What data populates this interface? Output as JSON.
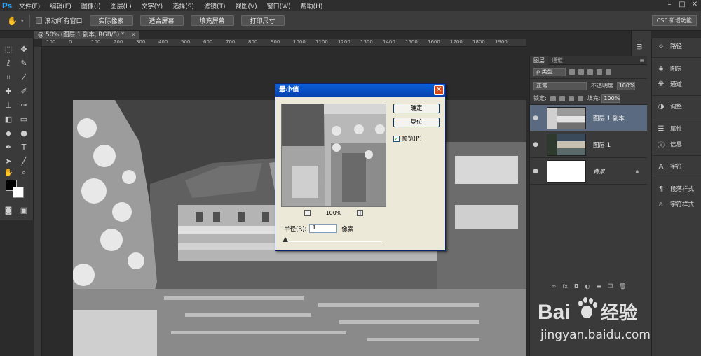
{
  "menubar": {
    "logo": "Ps",
    "items": [
      "文件(F)",
      "编辑(E)",
      "图像(I)",
      "图层(L)",
      "文字(Y)",
      "选择(S)",
      "滤镜(T)",
      "视图(V)",
      "窗口(W)",
      "帮助(H)"
    ]
  },
  "options": {
    "scroll_all_label": "滚动所有窗口",
    "buttons": [
      "实际像素",
      "适合屏幕",
      "填充屏幕",
      "打印尺寸"
    ],
    "workspace": "CS6 新增功能"
  },
  "document": {
    "tab_title": "@ 50% (图层 1 副本, RGB/8) *",
    "ruler_ticks": [
      "100",
      "0",
      "100",
      "200",
      "300",
      "400",
      "500",
      "600",
      "700",
      "800",
      "900",
      "1000",
      "1100",
      "1200",
      "1300",
      "1400",
      "1500",
      "1600",
      "1700",
      "1800",
      "1900"
    ]
  },
  "dialog": {
    "title": "最小值",
    "ok": "确定",
    "reset": "复位",
    "preview_label": "预览(P)",
    "preview_checked": true,
    "zoom": "100%",
    "zoom_out": "−",
    "zoom_in": "+",
    "radius_label": "半径(R):",
    "radius_value": "1",
    "radius_unit": "像素"
  },
  "layers_panel": {
    "tabs": [
      "图层",
      "通道"
    ],
    "kind": "ρ 类型",
    "blend_mode": "正常",
    "opacity_label": "不透明度:",
    "opacity": "100%",
    "lock_label": "锁定:",
    "fill_label": "填充:",
    "fill": "100%",
    "layers": [
      {
        "name": "图层 1 副本",
        "selected": true
      },
      {
        "name": "图层 1",
        "selected": false
      },
      {
        "name": "背景",
        "selected": false,
        "locked": true
      }
    ]
  },
  "side_panels": {
    "items": [
      "路径",
      "图层",
      "通道",
      "调整",
      "属性",
      "信息",
      "字符",
      "段落样式",
      "字符样式"
    ]
  },
  "watermark": {
    "brand": "Bai",
    "brand2": "经验",
    "url": "jingyan.baidu.com"
  }
}
